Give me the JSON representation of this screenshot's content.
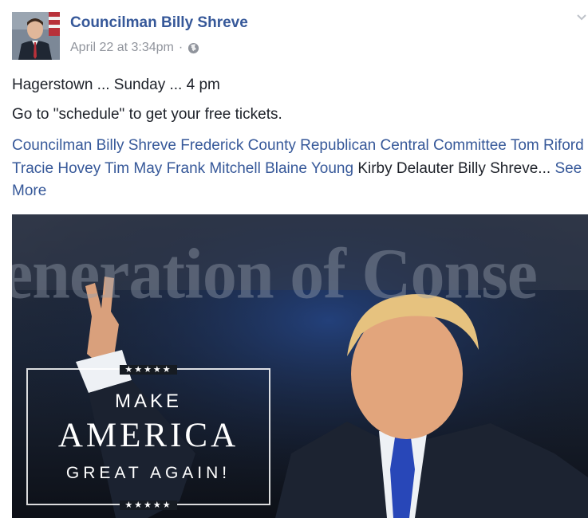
{
  "post": {
    "author": "Councilman Billy Shreve",
    "timestamp": "April 22 at 3:34pm",
    "separator": "·",
    "privacy_icon": "globe-icon",
    "options_icon": "chevron-down-icon",
    "lines": [
      "Hagerstown ... Sunday ... 4 pm",
      "Go to \"schedule\" to get your free tickets."
    ],
    "tags": [
      "Councilman Billy Shreve",
      "Frederick County Republican Central Committee",
      "Tom Riford",
      "Tracie Hovey",
      "Tim May",
      "Frank Mitchell",
      "Blaine Young"
    ],
    "plain_tags": "Kirby Delauter Billy Shreve...",
    "see_more": "See More",
    "image": {
      "background_banner": "eneration of Conse",
      "overlay": {
        "stars": "★★★★★",
        "line1": "MAKE",
        "line2": "AMERICA",
        "line3": "GREAT AGAIN!"
      }
    }
  },
  "colors": {
    "link": "#365899",
    "text": "#1d2129",
    "meta": "#90949c"
  }
}
